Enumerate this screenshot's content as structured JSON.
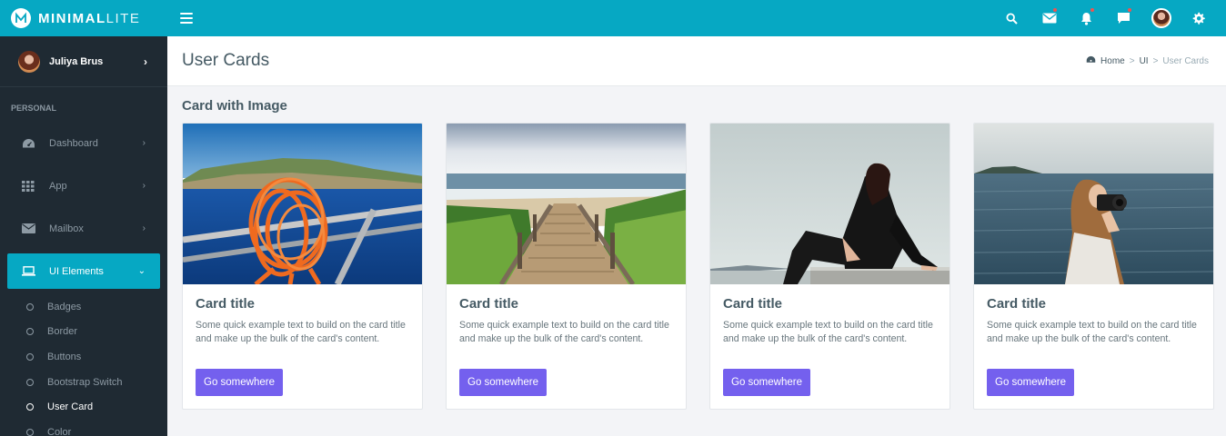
{
  "app": {
    "brand_bold": "MINIMAL",
    "brand_light": "LITE"
  },
  "topbar": {
    "icons": [
      "search-icon",
      "mail-icon",
      "bell-icon",
      "chat-icon",
      "user-avatar",
      "gear-icon"
    ]
  },
  "sidebar": {
    "user_name": "Juliya Brus",
    "section_label": "PERSONAL",
    "items": [
      {
        "label": "Dashboard",
        "icon": "dashboard-icon"
      },
      {
        "label": "App",
        "icon": "grid-icon"
      },
      {
        "label": "Mailbox",
        "icon": "envelope-icon"
      },
      {
        "label": "UI Elements",
        "icon": "laptop-icon",
        "active": true
      }
    ],
    "subitems": [
      {
        "label": "Badges"
      },
      {
        "label": "Border"
      },
      {
        "label": "Buttons"
      },
      {
        "label": "Bootstrap Switch"
      },
      {
        "label": "User Card",
        "current": true
      },
      {
        "label": "Color"
      }
    ]
  },
  "header": {
    "title": "User Cards",
    "breadcrumb": [
      "Home",
      "UI",
      "User Cards"
    ]
  },
  "main": {
    "section_title": "Card with Image",
    "cards": [
      {
        "title": "Card title",
        "text": "Some quick example text to build on the card title and make up the bulk of the card's content.",
        "button": "Go somewhere",
        "image": "orange rope on boat railing over blue sea"
      },
      {
        "title": "Card title",
        "text": "Some quick example text to build on the card title and make up the bulk of the card's content.",
        "button": "Go somewhere",
        "image": "wooden boardwalk steps leading to beach"
      },
      {
        "title": "Card title",
        "text": "Some quick example text to build on the card title and make up the bulk of the card's content.",
        "button": "Go somewhere",
        "image": "woman in black sitting on ledge"
      },
      {
        "title": "Card title",
        "text": "Some quick example text to build on the card title and make up the bulk of the card's content.",
        "button": "Go somewhere",
        "image": "woman with camera by the sea"
      }
    ]
  },
  "colors": {
    "primary": "#06a8c3",
    "sidebar": "#1f2a33",
    "button": "#7460ee",
    "background": "#f3f4f7"
  }
}
